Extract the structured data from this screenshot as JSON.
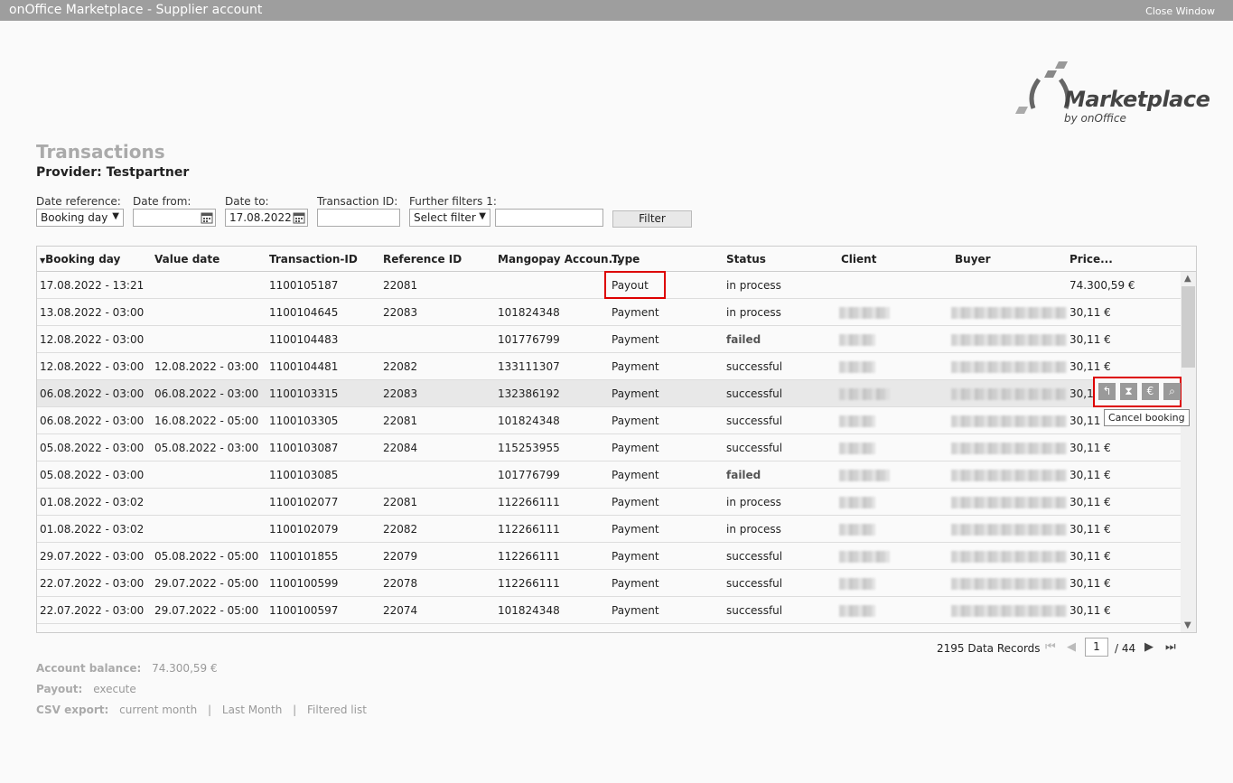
{
  "window": {
    "title": "onOffice Marketplace - Supplier account",
    "close": "Close Window"
  },
  "logo": {
    "name": "Marketplace",
    "sub": "by onOffice"
  },
  "page": {
    "title": "Transactions",
    "provider": "Provider: Testpartner"
  },
  "filters": {
    "date_reference_label": "Date reference:",
    "date_reference_value": "Booking day",
    "date_from_label": "Date from:",
    "date_from_value": "",
    "date_to_label": "Date to:",
    "date_to_value": "17.08.2022",
    "transaction_id_label": "Transaction ID:",
    "transaction_id_value": "",
    "further_label": "Further filters 1:",
    "further_value": "Select filter",
    "further_text": "",
    "filter_button": "Filter"
  },
  "table": {
    "sort_icon": "sort-desc-icon",
    "columns": [
      "Booking day",
      "Value date",
      "Transaction-ID",
      "Reference ID",
      "Mangopay Accoun...",
      "Type",
      "Status",
      "Client",
      "Buyer",
      "Price..."
    ],
    "rows": [
      {
        "booking": "17.08.2022 - 13:21",
        "value": "",
        "tid": "1100105187",
        "ref": "22081",
        "mango": "",
        "type": "Payout",
        "status": "in process",
        "client": "",
        "buyer": "",
        "price": "74.300,59 €"
      },
      {
        "booking": "13.08.2022 - 03:00",
        "value": "",
        "tid": "1100104645",
        "ref": "22083",
        "mango": "101824348",
        "type": "Payment",
        "status": "in process",
        "price": "30,11 €"
      },
      {
        "booking": "12.08.2022 - 03:00",
        "value": "",
        "tid": "1100104483",
        "ref": "",
        "mango": "101776799",
        "type": "Payment",
        "status": "failed",
        "price": "30,11 €"
      },
      {
        "booking": "12.08.2022 - 03:00",
        "value": "12.08.2022 - 03:00",
        "tid": "1100104481",
        "ref": "22082",
        "mango": "133111307",
        "type": "Payment",
        "status": "successful",
        "price": "30,11 €"
      },
      {
        "booking": "06.08.2022 - 03:00",
        "value": "06.08.2022 - 03:00",
        "tid": "1100103315",
        "ref": "22083",
        "mango": "132386192",
        "type": "Payment",
        "status": "successful",
        "price": "30,1"
      },
      {
        "booking": "06.08.2022 - 03:00",
        "value": "16.08.2022 - 05:00",
        "tid": "1100103305",
        "ref": "22081",
        "mango": "101824348",
        "type": "Payment",
        "status": "successful",
        "price": "30,11 €"
      },
      {
        "booking": "05.08.2022 - 03:00",
        "value": "05.08.2022 - 03:00",
        "tid": "1100103087",
        "ref": "22084",
        "mango": "115253955",
        "type": "Payment",
        "status": "successful",
        "price": "30,11 €"
      },
      {
        "booking": "05.08.2022 - 03:00",
        "value": "",
        "tid": "1100103085",
        "ref": "",
        "mango": "101776799",
        "type": "Payment",
        "status": "failed",
        "price": "30,11 €"
      },
      {
        "booking": "01.08.2022 - 03:02",
        "value": "",
        "tid": "1100102077",
        "ref": "22081",
        "mango": "112266111",
        "type": "Payment",
        "status": "in process",
        "price": "30,11 €"
      },
      {
        "booking": "01.08.2022 - 03:02",
        "value": "",
        "tid": "1100102079",
        "ref": "22082",
        "mango": "112266111",
        "type": "Payment",
        "status": "in process",
        "price": "30,11 €"
      },
      {
        "booking": "29.07.2022 - 03:00",
        "value": "05.08.2022 - 05:00",
        "tid": "1100101855",
        "ref": "22079",
        "mango": "112266111",
        "type": "Payment",
        "status": "successful",
        "price": "30,11 €"
      },
      {
        "booking": "22.07.2022 - 03:00",
        "value": "29.07.2022 - 05:00",
        "tid": "1100100599",
        "ref": "22078",
        "mango": "112266111",
        "type": "Payment",
        "status": "successful",
        "price": "30,11 €"
      },
      {
        "booking": "22.07.2022 - 03:00",
        "value": "29.07.2022 - 05:00",
        "tid": "1100100597",
        "ref": "22074",
        "mango": "101824348",
        "type": "Payment",
        "status": "successful",
        "price": "30,11 €"
      }
    ]
  },
  "row_actions": {
    "icons": [
      "undo-icon",
      "hourglass-icon",
      "euro-icon",
      "magnifier-icon"
    ],
    "glyphs": [
      "↰",
      "⧗",
      "€",
      "⌕"
    ],
    "tooltip": "Cancel booking"
  },
  "pager": {
    "records": "2195 Data Records",
    "page": "1",
    "of": "/ 44"
  },
  "footer": {
    "balance_label": "Account balance:",
    "balance_value": "74.300,59 €",
    "payout_label": "Payout:",
    "payout_value": "execute",
    "csv_label": "CSV export:",
    "csv_current": "current month",
    "csv_last": "Last Month",
    "csv_filtered": "Filtered list",
    "sep": "|"
  },
  "colors": {
    "highlight": "#dd0000",
    "titlebar": "#9e9e9e"
  }
}
